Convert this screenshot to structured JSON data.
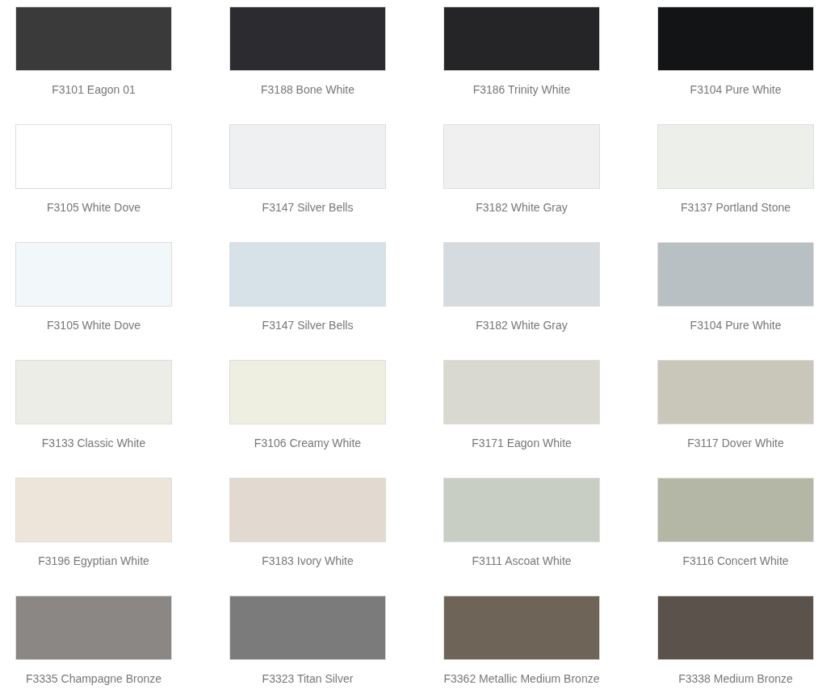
{
  "swatches": [
    {
      "label": "F3101 Eagon 01",
      "color": "#3a3a3a"
    },
    {
      "label": "F3188 Bone White",
      "color": "#2c2c30"
    },
    {
      "label": "F3186 Trinity White",
      "color": "#252527"
    },
    {
      "label": "F3104 Pure White",
      "color": "#131416"
    },
    {
      "label": "F3105 White Dove",
      "color": "#ffffff"
    },
    {
      "label": "F3147 Silver Bells",
      "color": "#eff0f2"
    },
    {
      "label": "F3182 White Gray",
      "color": "#f0f0f0"
    },
    {
      "label": "F3137 Portland Stone",
      "color": "#edf0ea"
    },
    {
      "label": "F3105 White Dove",
      "color": "#f2f7fa"
    },
    {
      "label": "F3147 Silver Bells",
      "color": "#d6e1e8"
    },
    {
      "label": "F3182 White Gray",
      "color": "#d5dbde"
    },
    {
      "label": "F3104 Pure White",
      "color": "#b8c0c3"
    },
    {
      "label": "F3133 Classic White",
      "color": "#ecede6"
    },
    {
      "label": "F3106 Creamy White",
      "color": "#eeefe0"
    },
    {
      "label": "F3171 Eagon White",
      "color": "#d9d9d1"
    },
    {
      "label": "F3117 Dover White",
      "color": "#c9c7b9"
    },
    {
      "label": "F3196 Egyptian White",
      "color": "#ede5da"
    },
    {
      "label": "F3183 Ivory White",
      "color": "#e2d9d1"
    },
    {
      "label": "F3111 Ascoat White",
      "color": "#c8cec3"
    },
    {
      "label": "F3116 Concert White",
      "color": "#b4b7a6"
    },
    {
      "label": "F3335 Champagne Bronze",
      "color": "#8a8784"
    },
    {
      "label": "F3323 Titan Silver",
      "color": "#7c7b7b"
    },
    {
      "label": "F3362 Metallic Medium Bronze",
      "color": "#6e6558"
    },
    {
      "label": "F3338 Medium Bronze",
      "color": "#5b524b"
    }
  ]
}
